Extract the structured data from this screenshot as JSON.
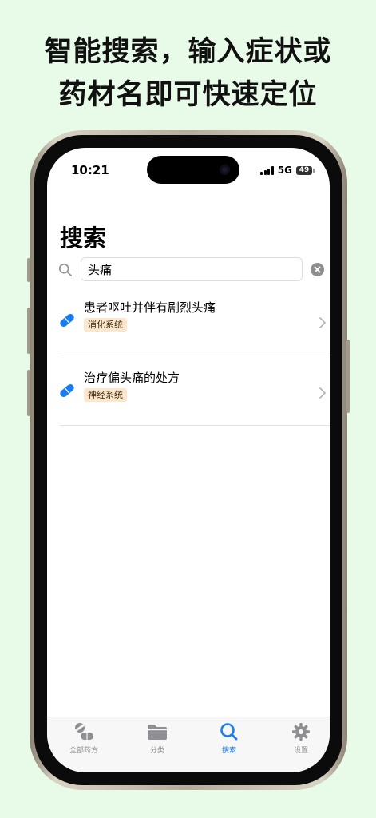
{
  "headline": {
    "line1": "智能搜索，输入症状或",
    "line2": "药材名即可快速定位"
  },
  "status_bar": {
    "time": "10:21",
    "network": "5G",
    "battery": "49"
  },
  "page": {
    "title": "搜索"
  },
  "search": {
    "value": "头痛",
    "placeholder": ""
  },
  "results": [
    {
      "title": "患者呕吐并伴有剧烈头痛",
      "tag": "消化系统"
    },
    {
      "title": "治疗偏头痛的处方",
      "tag": "神经系统"
    }
  ],
  "tabs": [
    {
      "label": "全部药方",
      "icon": "pills-icon",
      "active": false
    },
    {
      "label": "分类",
      "icon": "folder-icon",
      "active": false
    },
    {
      "label": "搜索",
      "icon": "search-icon",
      "active": true
    },
    {
      "label": "设置",
      "icon": "gear-icon",
      "active": false
    }
  ],
  "colors": {
    "accent": "#1a7cf2",
    "tag_bg": "#fde7cc",
    "background": "#e8fbe8"
  }
}
